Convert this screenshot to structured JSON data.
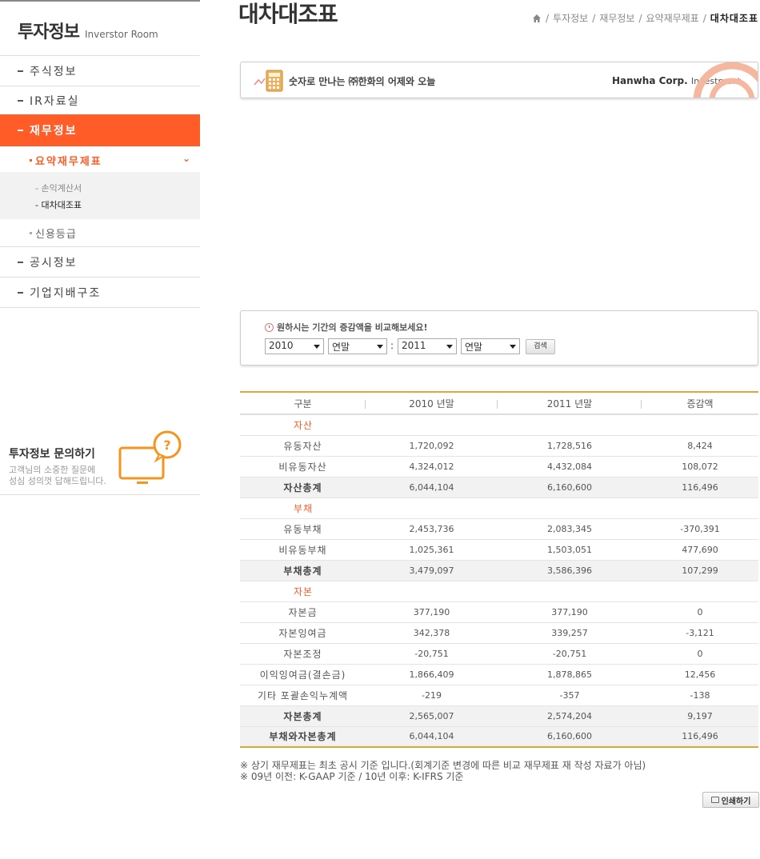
{
  "sidebar": {
    "brand_ko": "투자정보",
    "brand_en": "Inverstor Room",
    "nav": [
      {
        "label": "주식정보"
      },
      {
        "label": "IR자료실"
      },
      {
        "label": "재무정보"
      },
      {
        "label": "공시정보"
      },
      {
        "label": "기업지배구조"
      }
    ],
    "sub": {
      "summary": "요약재무제표",
      "income": "- 손익계산서",
      "balance": "- 대차대조표",
      "credit": "신용등급"
    },
    "inquiry": {
      "title": "투자정보 문의하기",
      "desc_line1": "고객님의 소중한 질문에",
      "desc_line2": "성심 성의껏 답해드립니다."
    }
  },
  "header": {
    "title": "대차대조표",
    "breadcrumb": [
      "투자정보",
      "재무정보",
      "요약재무제표"
    ],
    "breadcrumb_current": "대차대조표"
  },
  "banner": {
    "text": "숫자로 만나는 ㈜한화의 어제와 오늘",
    "brand": "Hanwha Corp.",
    "brand_sub": "Investment"
  },
  "compare": {
    "prompt": "원하시는 기간의 증감액을 비교해보세요!",
    "year_from": "2010",
    "period_from": "연말",
    "year_to": "2011",
    "period_to": "연말",
    "colon": ":",
    "search_label": "검색"
  },
  "table": {
    "headers": [
      "구분",
      "2010 년말",
      "2011 년말",
      "증감액"
    ],
    "rows": [
      {
        "type": "cat",
        "label": "자산",
        "v1": "",
        "v2": "",
        "v3": ""
      },
      {
        "type": "row",
        "label": "유동자산",
        "v1": "1,720,092",
        "v2": "1,728,516",
        "v3": "8,424"
      },
      {
        "type": "row",
        "label": "비유동자산",
        "v1": "4,324,012",
        "v2": "4,432,084",
        "v3": "108,072"
      },
      {
        "type": "total",
        "label": "자산총계",
        "v1": "6,044,104",
        "v2": "6,160,600",
        "v3": "116,496"
      },
      {
        "type": "cat",
        "label": "부채",
        "v1": "",
        "v2": "",
        "v3": ""
      },
      {
        "type": "row",
        "label": "유동부채",
        "v1": "2,453,736",
        "v2": "2,083,345",
        "v3": "-370,391"
      },
      {
        "type": "row",
        "label": "비유동부채",
        "v1": "1,025,361",
        "v2": "1,503,051",
        "v3": "477,690"
      },
      {
        "type": "total",
        "label": "부채총계",
        "v1": "3,479,097",
        "v2": "3,586,396",
        "v3": "107,299"
      },
      {
        "type": "cat",
        "label": "자본",
        "v1": "",
        "v2": "",
        "v3": ""
      },
      {
        "type": "row",
        "label": "자본금",
        "v1": "377,190",
        "v2": "377,190",
        "v3": "0"
      },
      {
        "type": "row",
        "label": "자본잉여금",
        "v1": "342,378",
        "v2": "339,257",
        "v3": "-3,121"
      },
      {
        "type": "row",
        "label": "자본조정",
        "v1": "-20,751",
        "v2": "-20,751",
        "v3": "0"
      },
      {
        "type": "row",
        "label": "이익잉여금(결손금)",
        "v1": "1,866,409",
        "v2": "1,878,865",
        "v3": "12,456"
      },
      {
        "type": "row",
        "label": "기타 포괄손익누계액",
        "v1": "-219",
        "v2": "-357",
        "v3": "-138"
      },
      {
        "type": "total",
        "label": "자본총계",
        "v1": "2,565,007",
        "v2": "2,574,204",
        "v3": "9,197"
      },
      {
        "type": "total last",
        "label": "부채와자본총계",
        "v1": "6,044,104",
        "v2": "6,160,600",
        "v3": "116,496"
      }
    ]
  },
  "notes": [
    "※ 상기 재무제표는 최초 공시 기준 입니다.(회계기준 변경에 따른 비교 재무제표 재 작성 자료가 아님)",
    "※ 09년 이전: K-GAAP 기준 / 10년 이후: K-IFRS 기준"
  ],
  "print_label": "인쇄하기",
  "colors": {
    "accent": "#ff5c28",
    "gold": "#e3a53a"
  }
}
